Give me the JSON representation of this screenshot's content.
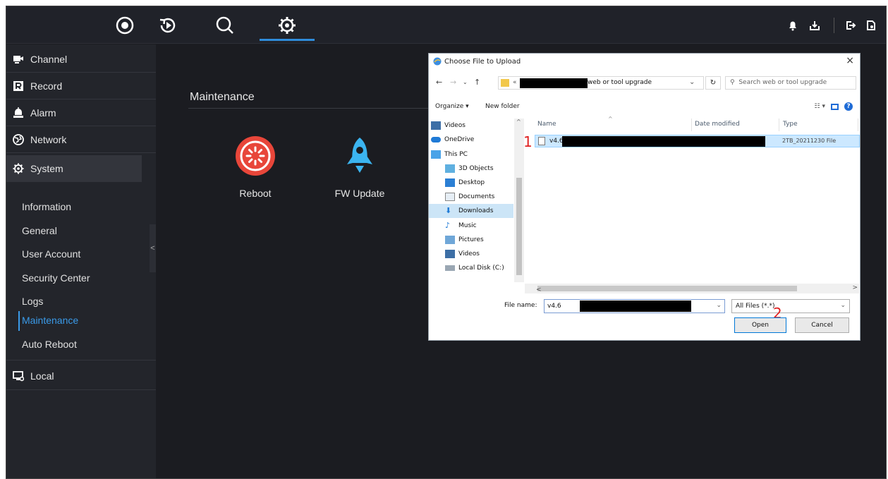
{
  "sidebar": {
    "sections": [
      {
        "label": "Channel",
        "icon": "camera-icon"
      },
      {
        "label": "Record",
        "icon": "record-icon"
      },
      {
        "label": "Alarm",
        "icon": "alarm-icon"
      },
      {
        "label": "Network",
        "icon": "network-icon"
      },
      {
        "label": "System",
        "icon": "gear-icon"
      }
    ],
    "system_items": [
      "Information",
      "General",
      "User Account",
      "Security Center",
      "Logs",
      "Maintenance",
      "Auto Reboot"
    ],
    "active_item": "Maintenance",
    "local": {
      "label": "Local",
      "icon": "local-icon"
    },
    "collapse_glyph": "<"
  },
  "main": {
    "title": "Maintenance",
    "tiles": [
      {
        "label": "Reboot",
        "icon": "reboot-icon",
        "color": "#e8463a"
      },
      {
        "label": "FW Update",
        "icon": "rocket-icon",
        "color": "#3bb4f0"
      }
    ]
  },
  "topbar": {
    "tabs": [
      "live-view-icon",
      "playback-icon",
      "search-icon",
      "settings-icon"
    ],
    "active_tab": "settings-icon",
    "right_icons": [
      "bell-icon",
      "download-icon",
      "logout-icon",
      "exit-icon"
    ]
  },
  "dialog": {
    "title": "Choose File to Upload",
    "close": "×",
    "address_prefix": "«",
    "address_tail": "web or tool upgrade",
    "search_placeholder": "Search web or tool upgrade",
    "organize": "Organize ▾",
    "new_folder": "New folder",
    "tree": [
      "Videos",
      "OneDrive",
      "This PC",
      "3D Objects",
      "Desktop",
      "Documents",
      "Downloads",
      "Music",
      "Pictures",
      "Videos",
      "Local Disk (C:)"
    ],
    "selected_tree": "Downloads",
    "columns": {
      "name": "Name",
      "date": "Date modified",
      "type": "Type"
    },
    "file": {
      "name": "v4.6",
      "type": "2TB_20211230 File"
    },
    "file_name_label": "File name:",
    "file_name_value": "v4.6",
    "filter": "All Files (*.*)",
    "open": "Open",
    "cancel": "Cancel",
    "marker_1": "1",
    "marker_2": "2"
  },
  "colors": {
    "accent": "#3a9ae8",
    "background": "#1b1c21",
    "sidebar": "#23252b"
  }
}
